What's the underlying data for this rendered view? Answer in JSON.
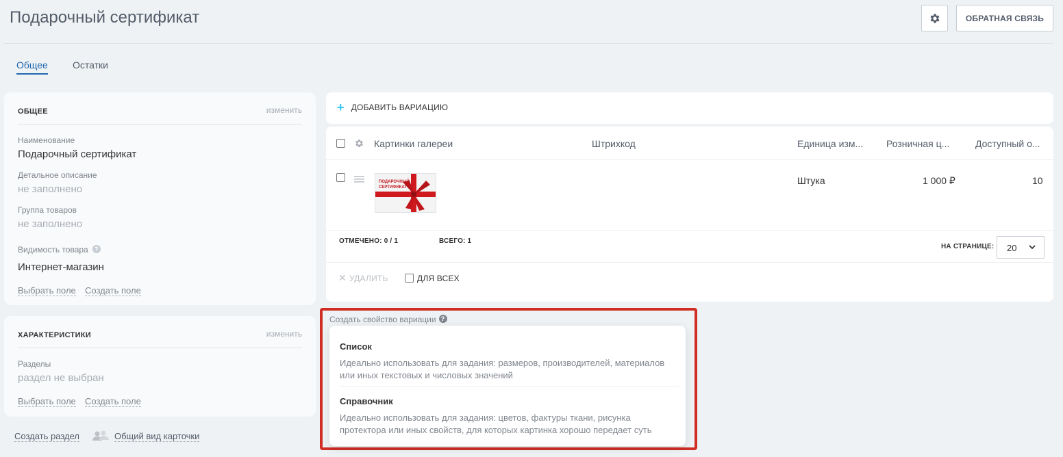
{
  "page": {
    "title": "Подарочный сертификат"
  },
  "header": {
    "feedback_label": "ОБРАТНАЯ СВЯЗЬ"
  },
  "tabs": [
    {
      "label": "Общее",
      "active": true
    },
    {
      "label": "Остатки",
      "active": false
    }
  ],
  "general": {
    "heading": "ОБЩЕЕ",
    "edit_label": "изменить",
    "name_label": "Наименование",
    "name_value": "Подарочный сертификат",
    "detail_label": "Детальное описание",
    "detail_value": "не заполнено",
    "group_label": "Группа товаров",
    "group_value": "не заполнено",
    "visibility_label": "Видимость товара",
    "visibility_value": "Интернет-магазин",
    "choose_field": "Выбрать поле",
    "create_field": "Создать поле"
  },
  "characteristics": {
    "heading": "ХАРАКТЕРИСТИКИ",
    "edit_label": "изменить",
    "sections_label": "Разделы",
    "sections_value": "раздел не выбран",
    "choose_field": "Выбрать поле",
    "create_field": "Создать поле"
  },
  "bottom_links": {
    "create_section": "Создать раздел",
    "card_view": "Общий вид карточки"
  },
  "variations": {
    "add_label": "ДОБАВИТЬ ВАРИАЦИЮ",
    "columns": [
      "Картинки галереи",
      "Штрихкод",
      "Единица изм...",
      "Розничная ц...",
      "Доступный о..."
    ],
    "rows": [
      {
        "image_text": "ПОДАРОЧНЫЙ СЕРТИФИКАТ",
        "barcode": "",
        "unit": "Штука",
        "price": "1 000 ₽",
        "available": "10"
      }
    ],
    "checked_label": "ОТМЕЧЕНО: 0 / 1",
    "total_label": "ВСЕГО: 1",
    "per_page_label": "НА СТРАНИЦЕ:",
    "per_page_value": "20",
    "delete_label": "УДАЛИТЬ",
    "for_all_label": "ДЛЯ ВСЕХ"
  },
  "create_property": {
    "label": "Создать свойство вариации",
    "options": [
      {
        "title": "Список",
        "description": "Идеально использовать для задания: размеров, производителей, материалов или иных текстовых и числовых значений"
      },
      {
        "title": "Справочник",
        "description": "Идеально использовать для задания: цветов, фактуры ткани, рисунка протектора или иных свойств, для которых картинка хорошо передает суть"
      }
    ]
  },
  "colors": {
    "accent": "#2067b0",
    "plus": "#2fc6f6",
    "highlight_frame": "#d02e25",
    "ribbon": "#d0191f"
  }
}
